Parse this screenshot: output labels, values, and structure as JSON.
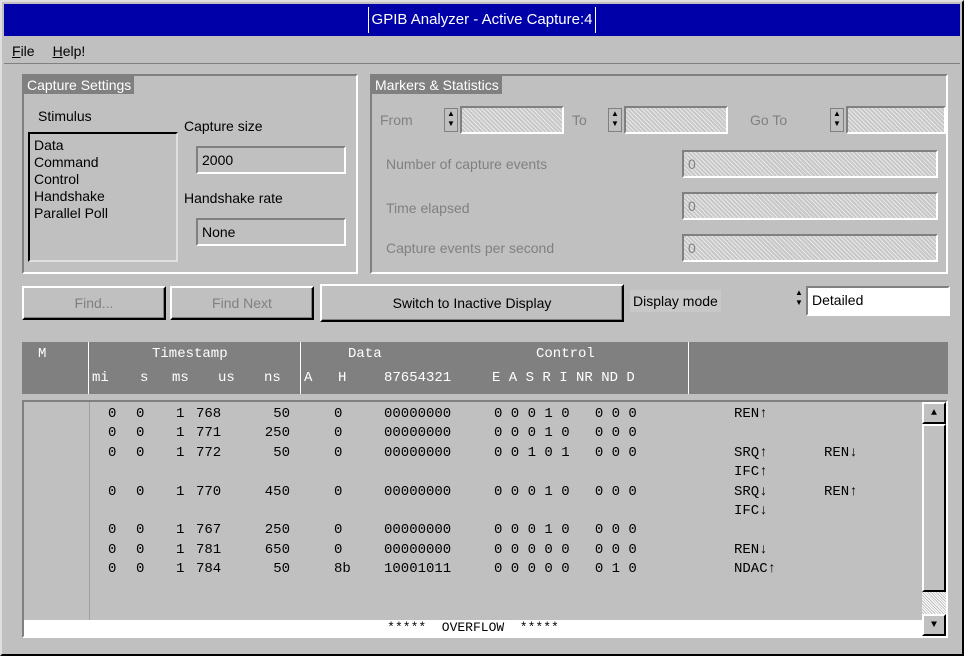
{
  "window": {
    "title": "GPIB Analyzer - Active Capture:4"
  },
  "menu": [
    {
      "label": "File"
    },
    {
      "label": "Help!"
    }
  ],
  "capture_settings": {
    "title": "Capture Settings",
    "stimulus_label": "Stimulus",
    "stimulus_items": [
      "Data",
      "Command",
      "Control",
      "Handshake",
      "Parallel Poll"
    ],
    "capture_size_label": "Capture size",
    "capture_size_value": "2000",
    "handshake_rate_label": "Handshake rate",
    "handshake_rate_value": "None"
  },
  "markers": {
    "title": "Markers & Statistics",
    "from_label": "From",
    "to_label": "To",
    "goto_label": "Go To",
    "num_events_label": "Number of capture events",
    "num_events_value": "0",
    "time_elapsed_label": "Time elapsed",
    "time_elapsed_value": "0",
    "events_per_sec_label": "Capture events per second",
    "events_per_sec_value": "0"
  },
  "toolbar": {
    "find_label": "Find...",
    "find_next_label": "Find Next",
    "switch_label": "Switch to Inactive Display",
    "display_mode_label": "Display mode",
    "display_mode_value": "Detailed"
  },
  "table_header": {
    "m": "M",
    "timestamp": "Timestamp",
    "data": "Data",
    "control": "Control",
    "mi": "mi",
    "s": "s",
    "ms": "ms",
    "us": "us",
    "ns": "ns",
    "a": "A",
    "h": "H",
    "bits": "87654321",
    "ctrl_bits": "E A S R I NR ND D"
  },
  "rows": [
    {
      "mi": "0",
      "s": "0",
      "ms": "1",
      "us": "768",
      "ns": "50",
      "h": "0",
      "bits": "00000000",
      "ctrl": "0 0 0 1 0   0 0 0",
      "ev1": "REN↑",
      "ev2": ""
    },
    {
      "mi": "0",
      "s": "0",
      "ms": "1",
      "us": "771",
      "ns": "250",
      "h": "0",
      "bits": "00000000",
      "ctrl": "0 0 0 1 0   0 0 0",
      "ev1": "",
      "ev2": ""
    },
    {
      "mi": "0",
      "s": "0",
      "ms": "1",
      "us": "772",
      "ns": "50",
      "h": "0",
      "bits": "00000000",
      "ctrl": "0 0 1 0 1   0 0 0",
      "ev1": "SRQ↑",
      "ev2": "REN↓"
    },
    {
      "mi": "",
      "s": "",
      "ms": "",
      "us": "",
      "ns": "",
      "h": "",
      "bits": "",
      "ctrl": "",
      "ev1": "IFC↑",
      "ev2": ""
    },
    {
      "mi": "0",
      "s": "0",
      "ms": "1",
      "us": "770",
      "ns": "450",
      "h": "0",
      "bits": "00000000",
      "ctrl": "0 0 0 1 0   0 0 0",
      "ev1": "SRQ↓",
      "ev2": "REN↑"
    },
    {
      "mi": "",
      "s": "",
      "ms": "",
      "us": "",
      "ns": "",
      "h": "",
      "bits": "",
      "ctrl": "",
      "ev1": "IFC↓",
      "ev2": ""
    },
    {
      "mi": "0",
      "s": "0",
      "ms": "1",
      "us": "767",
      "ns": "250",
      "h": "0",
      "bits": "00000000",
      "ctrl": "0 0 0 1 0   0 0 0",
      "ev1": "",
      "ev2": ""
    },
    {
      "mi": "0",
      "s": "0",
      "ms": "1",
      "us": "781",
      "ns": "650",
      "h": "0",
      "bits": "00000000",
      "ctrl": "0 0 0 0 0   0 0 0",
      "ev1": "REN↓",
      "ev2": ""
    },
    {
      "mi": "0",
      "s": "0",
      "ms": "1",
      "us": "784",
      "ns": "50",
      "h": "8b",
      "bits": "10001011",
      "ctrl": "0 0 0 0 0   0 1 0",
      "ev1": "NDAC↑",
      "ev2": ""
    }
  ],
  "overflow_text": "*****  OVERFLOW  *****"
}
